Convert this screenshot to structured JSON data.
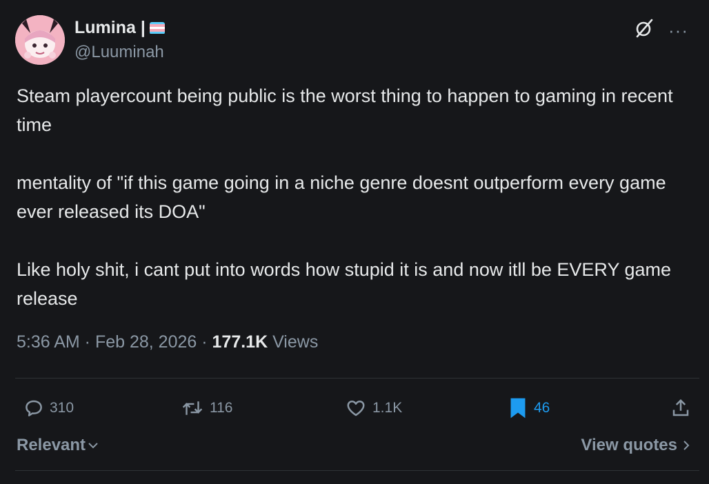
{
  "author": {
    "display_name": "Lumina |",
    "handle": "@Luuminah",
    "avatar_icon": "avatar-image",
    "flag_icon": "transgender-flag-icon"
  },
  "header_icons": {
    "grok_icon": "grok-icon",
    "more_icon": "more-options-icon",
    "more_glyph": "···"
  },
  "post": {
    "paragraphs": [
      "Steam playercount being public is the worst thing to happen to gaming in recent time",
      "mentality of \"if this game going in a niche genre doesnt outperform every game ever released its DOA\"",
      "Like holy shit, i cant put into words how stupid it is and now itll be EVERY game release"
    ]
  },
  "meta": {
    "time": "5:36 AM",
    "separator": " · ",
    "date": "Feb 28, 2026",
    "views_count": "177.1K",
    "views_label": " Views"
  },
  "actions": {
    "replies": "310",
    "reposts": "116",
    "likes": "1.1K",
    "bookmarks": "46"
  },
  "footer": {
    "sort_label": "Relevant",
    "view_quotes": "View quotes"
  },
  "colors": {
    "background": "#16171a",
    "text": "#e7e9ea",
    "muted": "#8b98a5",
    "accent": "#1d9bf0",
    "divider": "#2f3336"
  }
}
